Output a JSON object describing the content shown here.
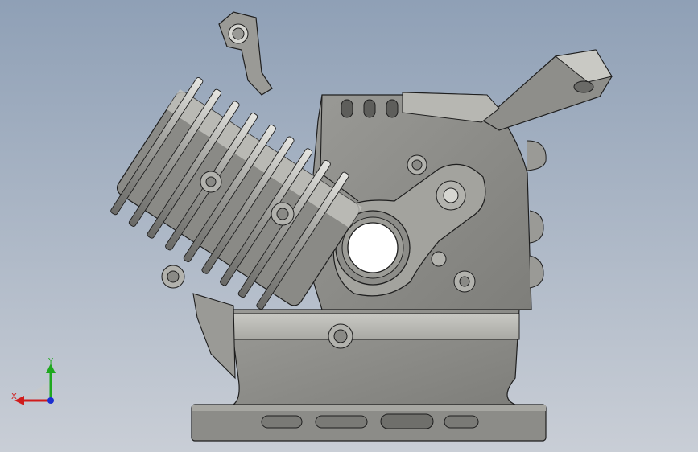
{
  "viewport": {
    "background_top": "#8fa0b6",
    "background_bottom": "#c9ced6"
  },
  "model": {
    "part_color": "#8a8a86",
    "edge_color": "#1e1e1e",
    "highlight_color": "#d9d9d4",
    "shadow_color": "#5a5a57"
  },
  "triad": {
    "x_label": "X",
    "y_label": "Y",
    "x_color": "#d01c1c",
    "y_color": "#1ea81e",
    "z_color": "#1c2fd0"
  }
}
